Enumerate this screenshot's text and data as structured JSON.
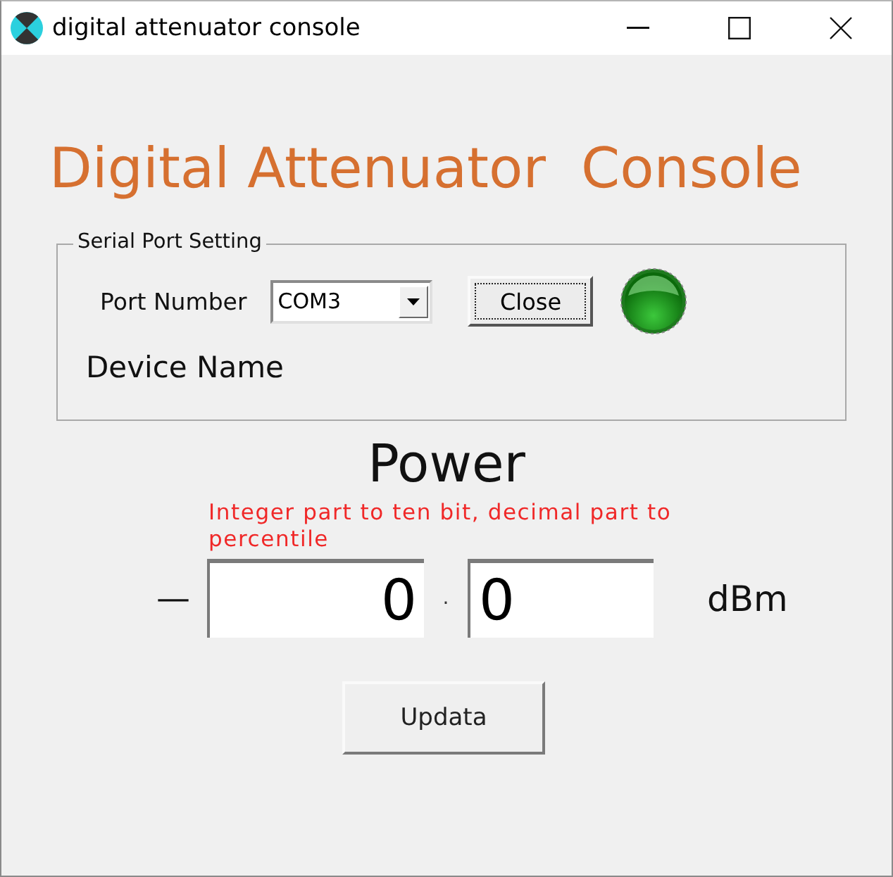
{
  "window": {
    "title": "digital attenuator console"
  },
  "heading": "Digital Attenuator  Console",
  "serial_port": {
    "title": "Serial Port Setting",
    "port_label": "Port Number",
    "port": {
      "value": "COM3"
    },
    "close_button": "Close",
    "connected": true,
    "device_name_label": "Device Name"
  },
  "power": {
    "title": "Power",
    "hint": "Integer part to ten bit, decimal part to percentile",
    "sign": "—",
    "integer_part": "0",
    "separator": ".",
    "decimal_part": "0",
    "unit": "dBm"
  },
  "buttons": [
    "Updata"
  ]
}
